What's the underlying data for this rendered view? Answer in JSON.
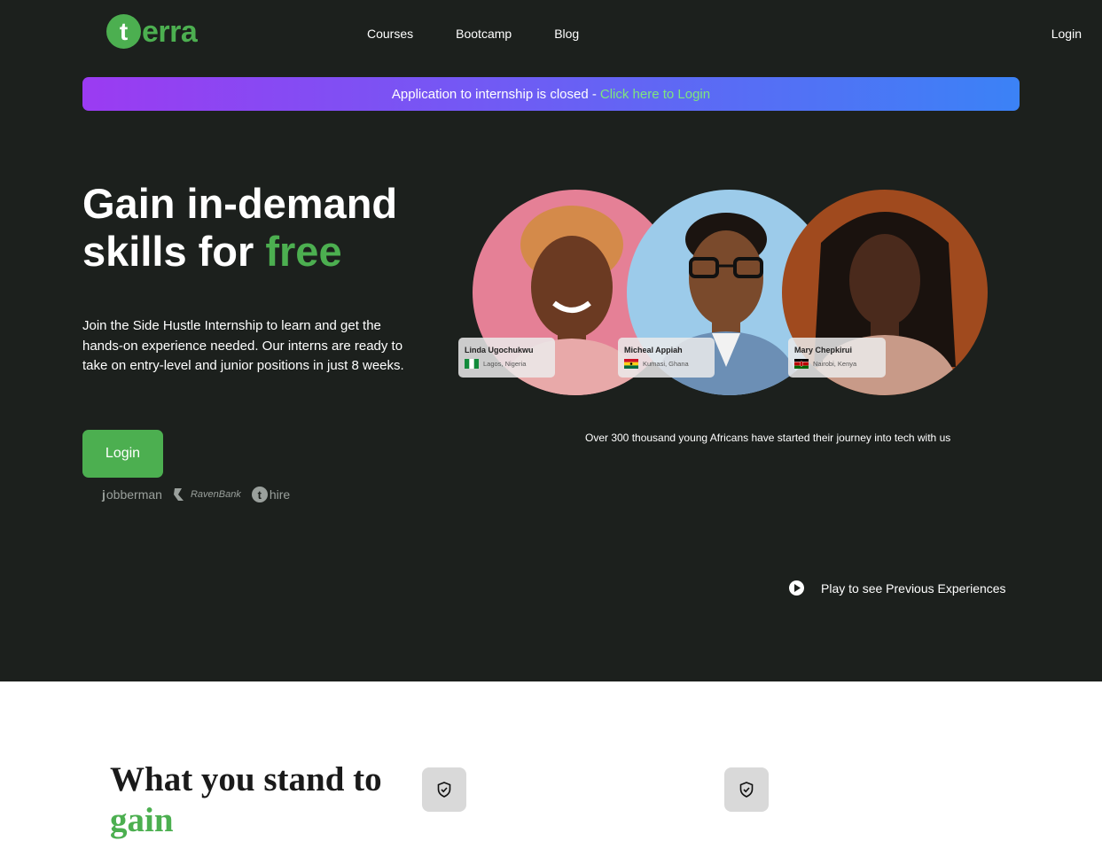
{
  "brand": {
    "mark": "t",
    "name": "erra",
    "accent": "#4caf50"
  },
  "nav": {
    "items": [
      "Courses",
      "Bootcamp",
      "Blog"
    ],
    "login": "Login"
  },
  "banner": {
    "text": "Application to internship is closed - ",
    "link": "Click here to Login"
  },
  "hero": {
    "headline_line1": "Gain in-demand",
    "headline_line2_prefix": "skills for ",
    "headline_line2_accent": "free",
    "description": "Join the Side Hustle Internship to learn and get the hands-on experience needed. Our interns are ready to take on entry-level and junior positions in just 8 weeks.",
    "cta_label": "Login",
    "partners": [
      "obberman",
      "RavenBank",
      "hire"
    ],
    "stat_text": "Over 300 thousand young Africans have started their journey into tech with us",
    "play_label": "Play to see Previous Experiences"
  },
  "testimonials": [
    {
      "name": "Linda Ugochukwu",
      "location": "Lagos, Nigeria",
      "flag": "nigeria"
    },
    {
      "name": "Micheal Appiah",
      "location": "Kumasi, Ghana",
      "flag": "ghana"
    },
    {
      "name": "Mary Chepkirui",
      "location": "Nairobi, Kenya",
      "flag": "kenya"
    }
  ],
  "benefits": {
    "title_line1": "What you stand to",
    "title_line2": "gain"
  }
}
